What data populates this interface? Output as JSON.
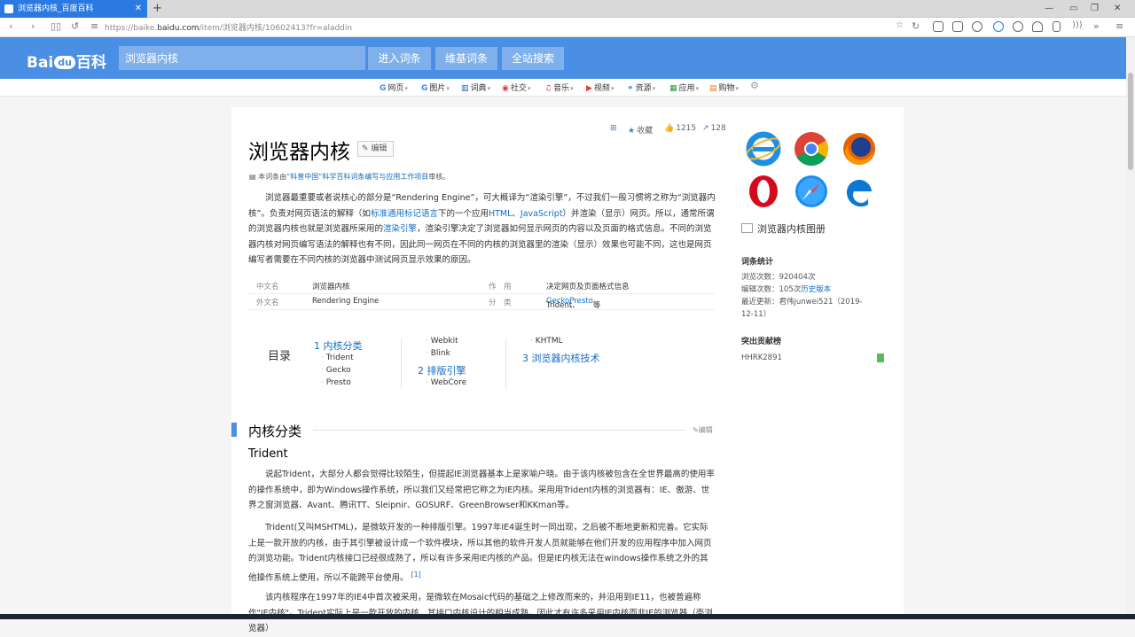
{
  "browser": {
    "tab_title": "浏览器内核_百度百科",
    "new_tab": "+",
    "url_prefix": "https://baike.",
    "url_domain": "baidu.com",
    "url_path": "/item/浏览器内核/10602413?fr=aladdin"
  },
  "header": {
    "logo_a": "Bai",
    "logo_du": "du",
    "logo_b": "百科",
    "search_value": "浏览器内核",
    "btn_enter": "进入词条",
    "btn_wiki": "维基词条",
    "btn_all": "全站搜索"
  },
  "channels": [
    {
      "icon": "G",
      "label": "网页",
      "color": "#4285f4"
    },
    {
      "icon": "G",
      "label": "图片",
      "color": "#4285f4"
    },
    {
      "icon": "▥",
      "label": "词典",
      "color": "#1a5fb4"
    },
    {
      "icon": "◉",
      "label": "社交",
      "color": "#e03c31"
    },
    {
      "icon": "♫",
      "label": "音乐",
      "color": "#e03c31"
    },
    {
      "icon": "▶",
      "label": "视频",
      "color": "#e03c31"
    },
    {
      "icon": "⚭",
      "label": "资源",
      "color": "#3a7fd6"
    },
    {
      "icon": "▦",
      "label": "应用",
      "color": "#2a9d3a"
    },
    {
      "icon": "▤",
      "label": "购物",
      "color": "#e07a1f"
    }
  ],
  "article": {
    "title": "浏览器内核",
    "edit": "编辑",
    "collect": "收藏",
    "likes": "1215",
    "shares": "128",
    "audit_pre": "本词条由",
    "audit_link": "“科普中国”科学百科词条编写与应用工作项目",
    "audit_post": "审核。",
    "intro": {
      "p1": "浏览器最重要或者说核心的部分是“Rendering Engine”，可大概译为“渲染引擎”，不过我们一般习惯将之称为“浏览器内核”。负责对网页语法的解释（如",
      "l1": "标准通用标记语言",
      "p2": "下的一个应用",
      "l2": "HTML",
      "p3": "、",
      "l3": "JavaScript",
      "p4": "）并渲染（显示）网页。所以，通常所谓的浏览器内核也就是浏览器所采用的",
      "l4": "渲染引擎",
      "p5": "，渲染引擎决定了浏览器如何显示网页的内容以及页面的格式信息。不同的浏览器内核对网页编写语法的解释也有不同，因此同一网页在不同的内核的浏览器里的渲染（显示）效果也可能不同，这也是网页编写者需要在不同内核的浏览器中测试网页显示效果的原因。"
    },
    "infobox": {
      "r1": {
        "k1": "中文名",
        "v1": "浏览器内核",
        "k2": "作　用",
        "v2": "决定网页及页面格式信息"
      },
      "r2": {
        "k1": "外文名",
        "v1": "Rendering Engine",
        "k2": "分　类",
        "v2a": "Trident、",
        "l1": "Gecko",
        "s": "、",
        "l2": "Presto",
        "v2b": "等"
      }
    },
    "toc": {
      "label": "目录",
      "c1": "1   内核分类",
      "c1a": "Trident",
      "c1b": "Gecko",
      "c1c": "Presto",
      "c1d": "Webkit",
      "c1e": "Blink",
      "c2": "2   排版引擎",
      "c2a": "WebCore",
      "c2b": "KHTML",
      "c3": "3   浏览器内核技术"
    },
    "section": {
      "title": "内核分类",
      "edit": "编辑"
    },
    "subsection": "Trident",
    "body": {
      "b1": "说起Trident，大部分人都会觉得比较陌生，但提起IE浏览器基本上是家喻户晓。由于该内核被包含在全世界最高的使用率的操作系统中，即为Windows操作系统，所以我们又经常把它称之为IE内核。采用用Trident内核的浏览器有：IE、傲游、世界之窗浏览器、Avant、腾讯TT、Sleipnir、GOSURF、GreenBrowser和KKman等。",
      "b2": "Trident(又叫MSHTML)，是微软开发的一种排版引擎。1997年IE4诞生时一同出现，之后被不断地更新和完善。它实际上是一款开放的内核，由于其引擎被设计成一个软件模块，所以其他的软件开发人员就能够在他们开发的应用程序中加入网页的浏览功能。Trident内核接口已经很成熟了，所以有许多采用IE内核的产品。但是IE内核无法在windows操作系统之外的其他操作系统上使用，所以不能跨平台使用。",
      "ref": "[1]",
      "b3": "该内核程序在1997年的IE4中首次被采用，是微软在Mosaic代码的基础之上修改而来的，并沿用到IE11，也被普遍称作\"IE内核\"。Trident实际上是一款开放的内核，其接口内核设计的相当成熟，因此才有许多采用IE内核而非IE的浏览器（壳浏览器）"
    }
  },
  "sidebar": {
    "gallery": "浏览器内核图册",
    "stats_title": "词条统计",
    "views": "浏览次数：920404次",
    "edits_pre": "编辑次数：105次",
    "edits_link": "历史版本",
    "updated": "最近更新：君伟junwei521（2019-12-11）",
    "contrib_title": "突出贡献榜",
    "contrib_user": "HHRK2891"
  }
}
